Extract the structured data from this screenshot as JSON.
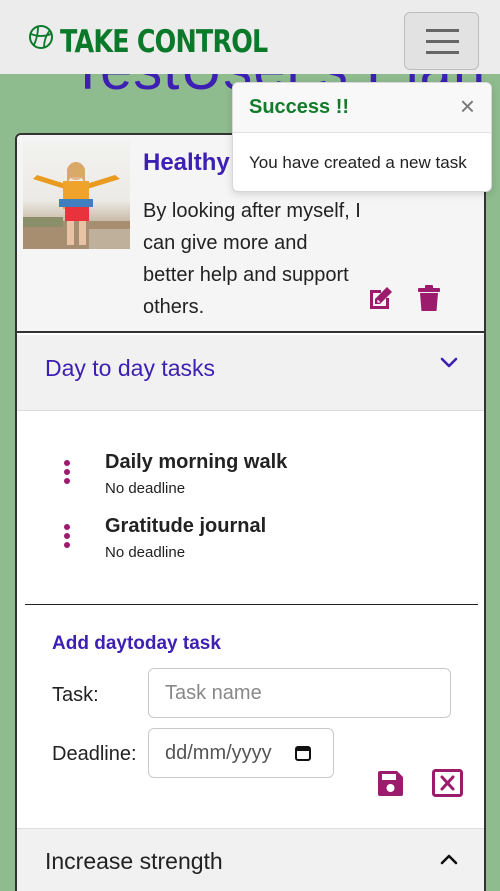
{
  "navbar": {
    "brand_text": "TAKE CONTROL",
    "brand_color": "#0a7a2a",
    "logo_icon": "basketball-icon",
    "toggler_icon": "hamburger-menu-icon"
  },
  "page": {
    "title": "TestUser's Plan"
  },
  "plan": {
    "title": "Healthy",
    "description": "By looking after myself, I can give more and better help and support others.",
    "image_alt": "woman-hiking-photo",
    "actions": {
      "edit_icon": "edit-icon",
      "delete_icon": "trash-icon"
    }
  },
  "sections": [
    {
      "label": "Day to day tasks",
      "expanded": true,
      "tasks": [
        {
          "title": "Daily morning walk",
          "deadline": "No deadline"
        },
        {
          "title": "Gratitude journal",
          "deadline": "No deadline"
        }
      ],
      "form": {
        "title": "Add daytoday task",
        "task_label": "Task:",
        "task_placeholder": "Task name",
        "deadline_label": "Deadline:",
        "deadline_placeholder": "dd/mm/yyyy",
        "save_icon": "floppy-disk-icon",
        "cancel_icon": "close-square-icon"
      }
    },
    {
      "label": "Increase strength",
      "expanded": false
    }
  ],
  "toast": {
    "title": "Success !!",
    "close": "×",
    "message": "You have created a new task"
  },
  "colors": {
    "accent": "#3d1fb3",
    "icon_magenta": "#9b1c6c",
    "success": "#137c2b",
    "background": "#8fbc8f"
  }
}
